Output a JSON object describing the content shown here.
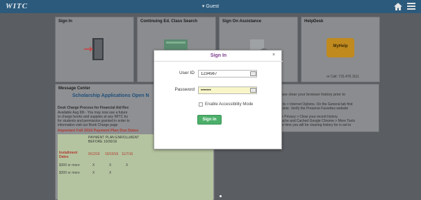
{
  "topbar": {
    "brand": "WITC",
    "user": "▾ Guest"
  },
  "tiles": {
    "signin": "Sign In",
    "continuing": "Continuing Ed. Class Search",
    "signon_help": "Sign On Assistance",
    "helpdesk": "HelpDesk",
    "helpdesk_call": "or Call: 715.476.1111",
    "helpdesk_logo": "MyHelp"
  },
  "message_center": {
    "title": "Message Center",
    "headline": "Scholarship Applications Open N",
    "lines": [
      "Desk Charge Process for Financial Aid Rec",
      "Available Aug 6th - You may now use a future",
      "to charge books and supplies at any WITC bo",
      "for students and permission granted in order to",
      "information visit our Book Charge page"
    ],
    "plan_title": "Important Fall 2016 Payment Plan Due Dates",
    "plan_header": "PAYMENT PLAN ENROLLMENT BEFORE 10/30/16",
    "installment_label": "Installment Dates",
    "dates": [
      "9/12/16",
      "10/10/16",
      "11/7/16"
    ],
    "rows": [
      "$300 or more",
      "$300 or more"
    ],
    "mark": "X"
  },
  "right_panel": {
    "lines": [
      "ase clear your browser history prior to",
      "ols > Internet Options. On the General tab find",
      "elete. Verify the Preserve Favorites website",
      "> Privacy > Clear your recent history",
      "ache and Cached Google Chrome > More Tools",
      "le time you will be clearing history for is set to"
    ]
  },
  "modal": {
    "title": "Sign In",
    "close": "×",
    "userid_label": "User ID",
    "userid_value": "1234567",
    "password_label": "Password",
    "password_value": "•••••••",
    "accessibility_label": "Enable Accessibility Mode",
    "signin_button": "Sign In"
  },
  "colors": {
    "topbar": "#2c5a7c",
    "accent": "#7a3b8c",
    "button": "#4caf6a",
    "plan_title": "#c0392b"
  }
}
